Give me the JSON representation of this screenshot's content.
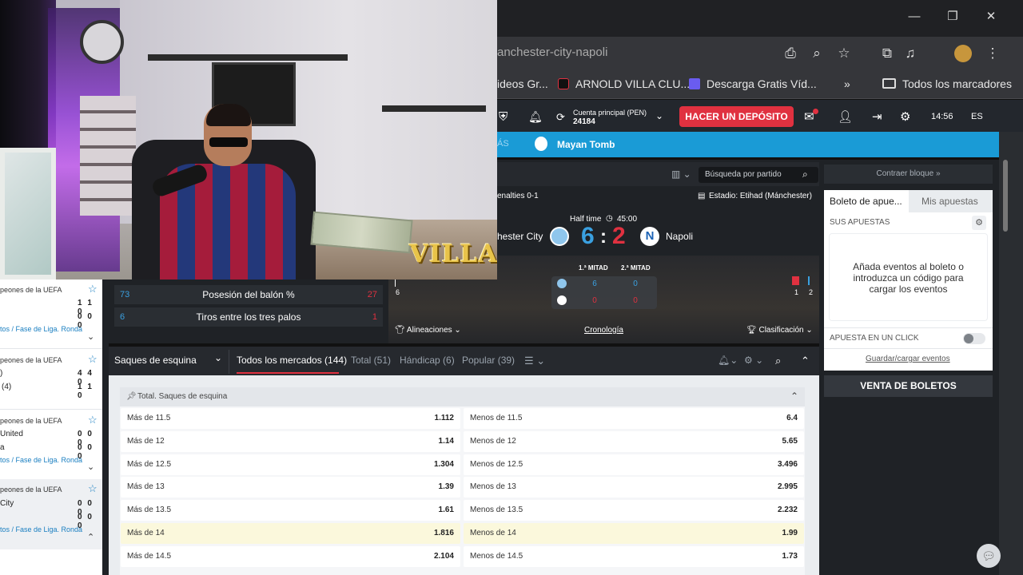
{
  "overlay": {
    "watermark": "VILLA"
  },
  "browser": {
    "url": "anchester-city-napoli",
    "bookmarks": [
      "ideos Gr...",
      "ARNOLD VILLA CLU...",
      "Descarga Gratis Víd...",
      "Todos los marcadores"
    ],
    "window_controls": [
      "—",
      "❐",
      "✕"
    ]
  },
  "site": {
    "account_label": "Cuenta principal  (PEN)",
    "balance": "24184",
    "deposit_label": "HACER UN DEPÓSITO",
    "time": "14:56",
    "lang": "ES",
    "nav_more": "ÁS",
    "nav_item": "Mayan Tomb"
  },
  "match": {
    "search_placeholder": "Búsqueda por partido",
    "penalties": "enalties 0-1",
    "stadium": "Estadio: Etihad (Mánchester)",
    "status": "Half time",
    "clock": "45:00",
    "home": "hester City",
    "away": "Napoli",
    "home_score": "6",
    "away_score": "2",
    "half_headers": [
      "1.ª MITAD",
      "2.ª MITAD"
    ],
    "half_home": [
      "6",
      "0"
    ],
    "half_away": [
      "0",
      "0"
    ],
    "cards": [
      "1",
      "2"
    ],
    "timeline_left": "6",
    "links": [
      "Alineaciones",
      "Cronología",
      "Clasificación"
    ],
    "stats": [
      {
        "home": "73",
        "label": "Posesión del balón %",
        "away": "27"
      },
      {
        "home": "6",
        "label": "Tiros entre los tres palos",
        "away": "1"
      }
    ]
  },
  "sidebar": {
    "groups": [
      {
        "title": "peones de la UEFA",
        "rows": [
          {
            "name": "",
            "score": "1 1 0"
          },
          {
            "name": "",
            "score": "0 0 0"
          }
        ],
        "link": "tos / Fase de Liga. Ronda"
      },
      {
        "title": "peones de la UEFA",
        "rows": [
          {
            "name": ")",
            "score": "4 4 0"
          },
          {
            "name": "(4)",
            "score": "1 1 0"
          }
        ],
        "link": ""
      },
      {
        "title": "peones de la UEFA",
        "rows": [
          {
            "name": "United",
            "score": "0 0 0"
          },
          {
            "name": "a",
            "score": "0 0 0"
          }
        ],
        "link": "tos / Fase de Liga. Ronda"
      },
      {
        "title": "peones de la UEFA",
        "rows": [
          {
            "name": "City",
            "score": "0 0 0"
          },
          {
            "name": "",
            "score": "0 0 0"
          }
        ],
        "link": "tos / Fase de Liga. Ronda"
      }
    ]
  },
  "markets": {
    "selected_market": "Saques de esquina",
    "tabs": [
      "Todos los mercados (144)",
      "Total (51)",
      "Hándicap (6)",
      "Popular (39)"
    ],
    "group_title": "Total. Saques de esquina",
    "rows": [
      {
        "over": "Más de 11.5",
        "over_odd": "1.112",
        "under": "Menos de 11.5",
        "under_odd": "6.4"
      },
      {
        "over": "Más de 12",
        "over_odd": "1.14",
        "under": "Menos de 12",
        "under_odd": "5.65"
      },
      {
        "over": "Más de 12.5",
        "over_odd": "1.304",
        "under": "Menos de 12.5",
        "under_odd": "3.496"
      },
      {
        "over": "Más de 13",
        "over_odd": "1.39",
        "under": "Menos de 13",
        "under_odd": "2.995"
      },
      {
        "over": "Más de 13.5",
        "over_odd": "1.61",
        "under": "Menos de 13.5",
        "under_odd": "2.232"
      },
      {
        "over": "Más de 14",
        "over_odd": "1.816",
        "under": "Menos de 14",
        "under_odd": "1.99"
      },
      {
        "over": "Más de 14.5",
        "over_odd": "2.104",
        "under": "Menos de 14.5",
        "under_odd": "1.73"
      }
    ]
  },
  "betslip": {
    "collapse_label": "Contraer bloque »",
    "tabs": [
      "Boleto de apue...",
      "Mis apuestas"
    ],
    "section": "SUS APUESTAS",
    "empty_text": "Añada eventos al boleto o introduzca un código para cargar los eventos",
    "one_click": "APUESTA EN UN CLICK",
    "save_load": "Guardar/cargar eventos",
    "sell_label": "VENTA DE BOLETOS"
  },
  "colors": {
    "accent": "#e03140",
    "nav": "#1a9bd6",
    "home_score": "#3aa0e0",
    "away_score": "#e03140"
  }
}
